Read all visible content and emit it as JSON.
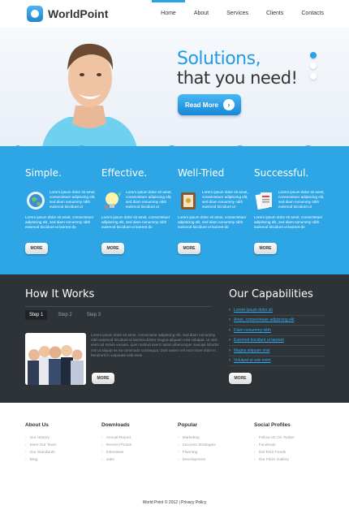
{
  "brand": {
    "name": "WorldPoint"
  },
  "nav": {
    "items": [
      {
        "label": "Home",
        "active": true
      },
      {
        "label": "About",
        "active": false
      },
      {
        "label": "Services",
        "active": false
      },
      {
        "label": "Clients",
        "active": false
      },
      {
        "label": "Contacts",
        "active": false
      }
    ]
  },
  "hero": {
    "title_line1": "Solutions,",
    "title_line2": "that you need!",
    "cta_label": "Read More",
    "slide_count": 3,
    "active_slide": 1
  },
  "features": [
    {
      "title": "Simple.",
      "icon": "globe-icon",
      "text": "Lorem ipsum dolor sit amet, consectetuer adipiscing elit, sed diam nonummy nibh euismod tincidunt ut",
      "text2": "Lorem ipsum dolor sit amet, consectetuer adipiscing elit, sed diam nonummy nibh euismod tincidunt ut laoreet do",
      "button": "MORE"
    },
    {
      "title": "Effective.",
      "icon": "lightbulb-icon",
      "text": "Lorem ipsum dolor sit amet, consectetuer adipiscing elit, sed diam nonummy nibh euismod tincidunt ut",
      "text2": "Lorem ipsum dolor sit amet, consectetuer adipiscing elit, sed diam nonummy nibh euismod tincidunt ut laoreet do",
      "button": "MORE"
    },
    {
      "title": "Well-Tried",
      "icon": "book-icon",
      "text": "Lorem ipsum dolor sit amet, consectetuer adipiscing elit, sed diam nonummy nibh euismod tincidunt ut",
      "text2": "Lorem ipsum dolor sit amet, consectetuer adipiscing elit, sed diam nonummy nibh euismod tincidunt ut laoreet do",
      "button": "MORE"
    },
    {
      "title": "Successful.",
      "icon": "documents-icon",
      "text": "Lorem ipsum dolor sit amet, consectetuer adipiscing elit, sed diam nonummy nibh euismod tincidunt ut",
      "text2": "Lorem ipsum dolor sit amet, consectetuer adipiscing elit, sed diam nonummy nibh euismod tincidunt ut laoreet do",
      "button": "MORE"
    }
  ],
  "how_it_works": {
    "title": "How It Works",
    "tabs": [
      "Step 1",
      "Step 2",
      "Step 3"
    ],
    "active_tab": 0,
    "text": "Lorem ipsum dolor sit amet, consectetur adipiscing elit, sed diam nonummy nibh euismod tincidunt ut laoreet dolore magna aliquam erat volutpat. Ut wisi enim ad minim veniam, quis nostrud exerci tation ullamcorper suscipit lobortis nisl ut aliquip ex ea commodo consequat. Duis autem vel eum iriure dolor in hendrerit in vulputate velit esse.",
    "button": "MORE"
  },
  "capabilities": {
    "title": "Our Capabilities",
    "items": [
      "Lorem ipsum dolor sit",
      "Amet, consectetuer adipiscing elit",
      "Diam nonummy nibh",
      "Euismod tincidunt ut laoreet",
      "Magna aliquam erat",
      "Volutpat ut wisi enim"
    ],
    "button": "MORE"
  },
  "footer": {
    "columns": [
      {
        "title": "About Us",
        "items": [
          "Our History",
          "Meet Our Team",
          "Our Standards",
          "Blog"
        ]
      },
      {
        "title": "Downloads",
        "items": [
          "Annual Report",
          "Recent Photos",
          "Interviews",
          "Jobs"
        ]
      },
      {
        "title": "Popular",
        "items": [
          "Marketing",
          "Success Strategies",
          "Planning",
          "Development"
        ]
      },
      {
        "title": "Social Profiles",
        "items": [
          "Follow Us On Twitter",
          "Facebook",
          "Get RSS Feeds",
          "Our Flickr Gallery"
        ]
      }
    ],
    "copyright": "World Point © 2012 | Privacy Policy"
  },
  "colors": {
    "accent": "#2ea6e6",
    "dark": "#2e3338",
    "link": "#30aaf0"
  }
}
